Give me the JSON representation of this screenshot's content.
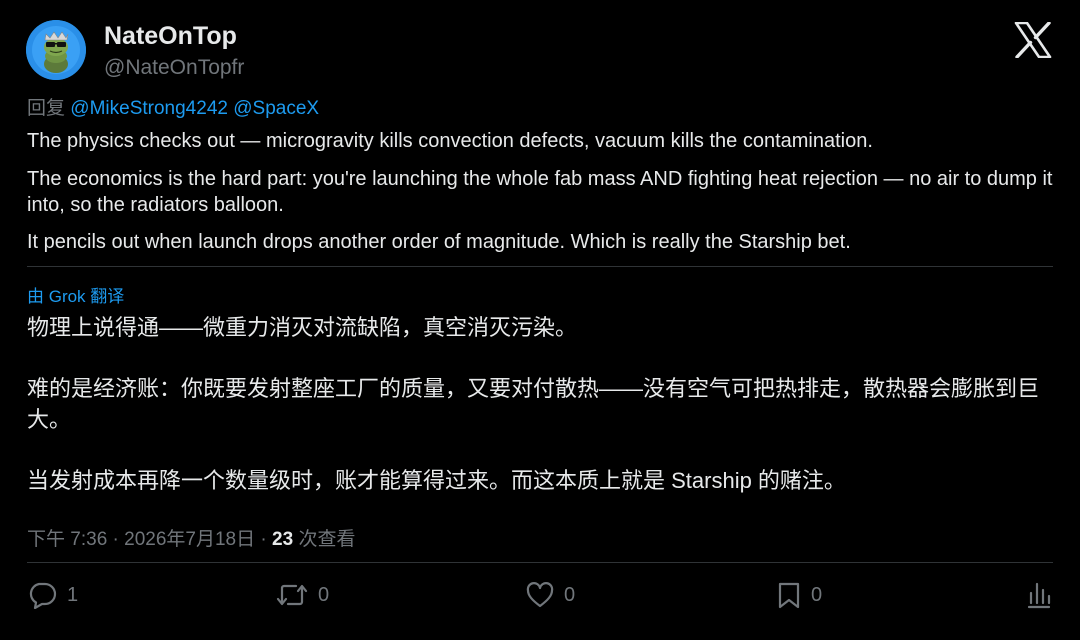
{
  "author": {
    "display_name": "NateOnTop",
    "handle": "@NateOnTopfr"
  },
  "reply": {
    "prefix": "回复",
    "mentions": [
      "@MikeStrong4242",
      "@SpaceX"
    ]
  },
  "post": {
    "paragraphs": [
      "The physics checks out — microgravity kills convection defects, vacuum kills the contamination.",
      "The economics is the hard part: you're launching the whole fab mass AND fighting heat rejection — no air to dump it into, so the radiators balloon.",
      "It pencils out when launch drops another order of magnitude. Which is really the Starship bet."
    ]
  },
  "translation": {
    "label": "由 Grok 翻译",
    "paragraphs": [
      "物理上说得通——微重力消灭对流缺陷，真空消灭污染。",
      "难的是经济账：你既要发射整座工厂的质量，又要对付散热——没有空气可把热排走，散热器会膨胀到巨大。",
      "当发射成本再降一个数量级时，账才能算得过来。而这本质上就是 Starship 的赌注。"
    ]
  },
  "meta": {
    "time": "下午 7:36",
    "date": "2026年7月18日",
    "views_count": "23",
    "views_label": "次查看",
    "separator": "·"
  },
  "actions": {
    "replies": "1",
    "reposts": "0",
    "likes": "0",
    "bookmarks": "0"
  },
  "icons": {
    "platform": "x-logo-icon",
    "reply": "comment-icon",
    "repost": "repost-icon",
    "like": "heart-icon",
    "bookmark": "bookmark-icon",
    "analytics": "analytics-icon"
  },
  "colors": {
    "background": "#000000",
    "text": "#e7e9ea",
    "muted": "#71767b",
    "accent": "#1d9bf0",
    "divider": "#2f3336"
  }
}
